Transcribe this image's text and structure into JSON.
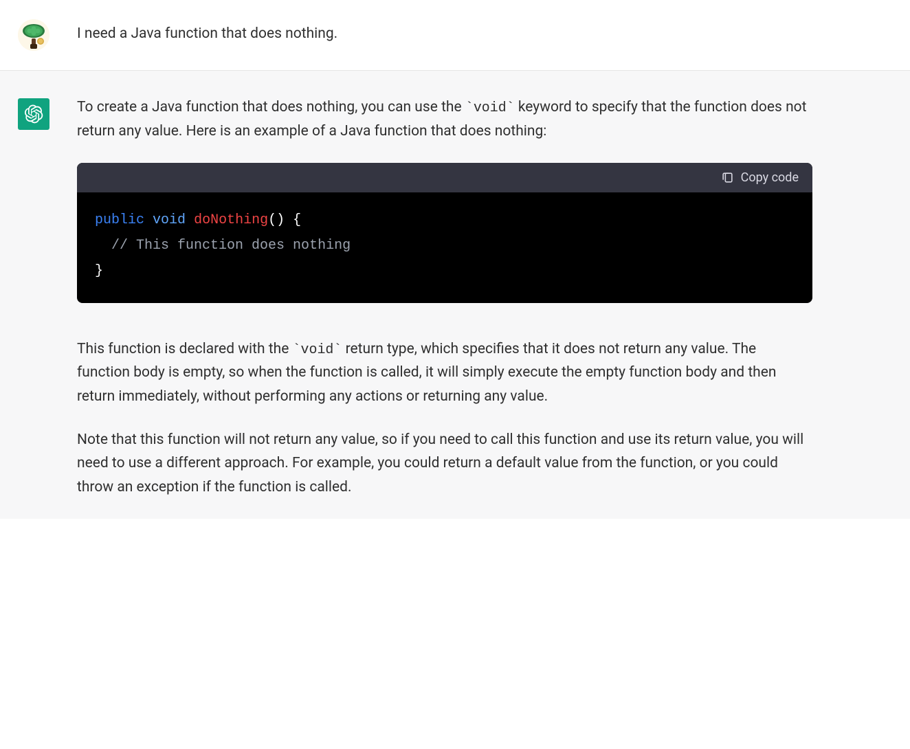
{
  "user": {
    "message": "I need a Java function that does nothing."
  },
  "assistant": {
    "paragraph1_pre": "To create a Java function that does nothing, you can use the ",
    "paragraph1_code": "`void`",
    "paragraph1_post": " keyword to specify that the function does not return any value. Here is an example of a Java function that does nothing:",
    "code": {
      "copy_label": "Copy code",
      "tokens": {
        "kw_public": "public",
        "kw_void": "void",
        "fn_name": "doNothing",
        "paren_open": "()",
        "brace_open": " {",
        "comment": "// This function does nothing",
        "brace_close": "}"
      }
    },
    "paragraph2_pre": "This function is declared with the ",
    "paragraph2_code": "`void`",
    "paragraph2_post": " return type, which specifies that it does not return any value. The function body is empty, so when the function is called, it will simply execute the empty function body and then return immediately, without performing any actions or returning any value.",
    "paragraph3": "Note that this function will not return any value, so if you need to call this function and use its return value, you will need to use a different approach. For example, you could return a default value from the function, or you could throw an exception if the function is called."
  }
}
